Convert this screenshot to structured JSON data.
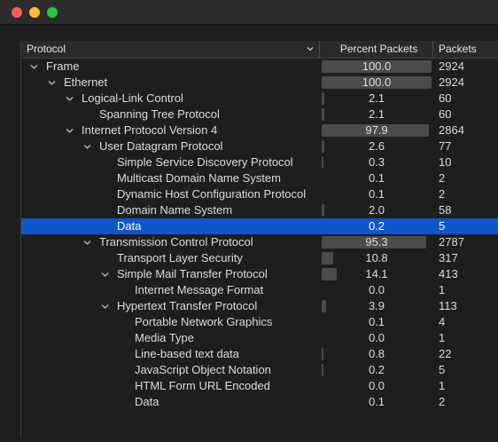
{
  "window": {
    "controls": [
      "close-button",
      "minimize-button",
      "zoom-button"
    ]
  },
  "table": {
    "columns": {
      "protocol": "Protocol",
      "percent": "Percent Packets",
      "packets": "Packets"
    },
    "selected_row": 10,
    "rows": [
      {
        "name": "Frame",
        "depth": 0,
        "expanded": true,
        "percent": "100.0",
        "packets": "2924",
        "level": 1.0
      },
      {
        "name": "Ethernet",
        "depth": 1,
        "expanded": true,
        "percent": "100.0",
        "packets": "2924",
        "level": 1.0
      },
      {
        "name": "Logical-Link Control",
        "depth": 2,
        "expanded": true,
        "percent": "2.1",
        "packets": "60",
        "level": 0.021
      },
      {
        "name": "Spanning Tree Protocol",
        "depth": 3,
        "expanded": null,
        "percent": "2.1",
        "packets": "60",
        "level": 0.021
      },
      {
        "name": "Internet Protocol Version 4",
        "depth": 2,
        "expanded": true,
        "percent": "97.9",
        "packets": "2864",
        "level": 0.979
      },
      {
        "name": "User Datagram Protocol",
        "depth": 3,
        "expanded": true,
        "percent": "2.6",
        "packets": "77",
        "level": 0.026
      },
      {
        "name": "Simple Service Discovery Protocol",
        "depth": 4,
        "expanded": null,
        "percent": "0.3",
        "packets": "10",
        "level": 0.003
      },
      {
        "name": "Multicast Domain Name System",
        "depth": 4,
        "expanded": null,
        "percent": "0.1",
        "packets": "2",
        "level": 0.001
      },
      {
        "name": "Dynamic Host Configuration Protocol",
        "depth": 4,
        "expanded": null,
        "percent": "0.1",
        "packets": "2",
        "level": 0.001
      },
      {
        "name": "Domain Name System",
        "depth": 4,
        "expanded": null,
        "percent": "2.0",
        "packets": "58",
        "level": 0.02
      },
      {
        "name": "Data",
        "depth": 4,
        "expanded": null,
        "percent": "0.2",
        "packets": "5",
        "level": 0.002
      },
      {
        "name": "Transmission Control Protocol",
        "depth": 3,
        "expanded": true,
        "percent": "95.3",
        "packets": "2787",
        "level": 0.953
      },
      {
        "name": "Transport Layer Security",
        "depth": 4,
        "expanded": null,
        "percent": "10.8",
        "packets": "317",
        "level": 0.108
      },
      {
        "name": "Simple Mail Transfer Protocol",
        "depth": 4,
        "expanded": true,
        "percent": "14.1",
        "packets": "413",
        "level": 0.141
      },
      {
        "name": "Internet Message Format",
        "depth": 5,
        "expanded": null,
        "percent": "0.0",
        "packets": "1",
        "level": 0.0
      },
      {
        "name": "Hypertext Transfer Protocol",
        "depth": 4,
        "expanded": true,
        "percent": "3.9",
        "packets": "113",
        "level": 0.039
      },
      {
        "name": "Portable Network Graphics",
        "depth": 5,
        "expanded": null,
        "percent": "0.1",
        "packets": "4",
        "level": 0.001
      },
      {
        "name": "Media Type",
        "depth": 5,
        "expanded": null,
        "percent": "0.0",
        "packets": "1",
        "level": 0.0
      },
      {
        "name": "Line-based text data",
        "depth": 5,
        "expanded": null,
        "percent": "0.8",
        "packets": "22",
        "level": 0.008
      },
      {
        "name": "JavaScript Object Notation",
        "depth": 5,
        "expanded": null,
        "percent": "0.2",
        "packets": "5",
        "level": 0.002
      },
      {
        "name": "HTML Form URL Encoded",
        "depth": 5,
        "expanded": null,
        "percent": "0.0",
        "packets": "1",
        "level": 0.0
      },
      {
        "name": "Data",
        "depth": 5,
        "expanded": null,
        "percent": "0.1",
        "packets": "2",
        "level": 0.001
      }
    ]
  },
  "colors": {
    "selection": "#0d57c7",
    "bar": "#4b4b4b",
    "background": "#1e1e1e",
    "text": "#dcdcdc"
  },
  "icons": {
    "sort": "chevron-down-icon",
    "expanded": "disclosure-open-icon"
  }
}
